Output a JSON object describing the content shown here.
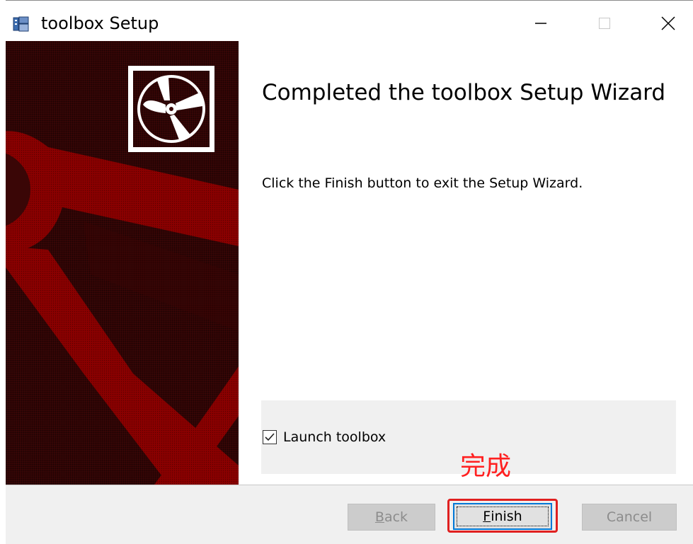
{
  "window": {
    "title": "toolbox Setup",
    "controls": {
      "minimize": "minimize-icon",
      "maximize": "maximize-icon",
      "close": "close-icon"
    }
  },
  "content": {
    "heading": "Completed the toolbox Setup Wizard",
    "description": "Click the Finish button to exit the Setup Wizard.",
    "launch_checkbox": {
      "label": "Launch toolbox",
      "checked": true
    },
    "annotation": "完成"
  },
  "buttons": {
    "back": {
      "label_first": "B",
      "label_rest": "ack",
      "enabled": false
    },
    "finish": {
      "label_first": "F",
      "label_rest": "inish",
      "enabled": true
    },
    "cancel": {
      "label": "Cancel",
      "enabled": false
    }
  },
  "colors": {
    "panel_red": "#8b0000",
    "annotation_red": "#ff2020",
    "highlight_outline": "#e02020"
  }
}
